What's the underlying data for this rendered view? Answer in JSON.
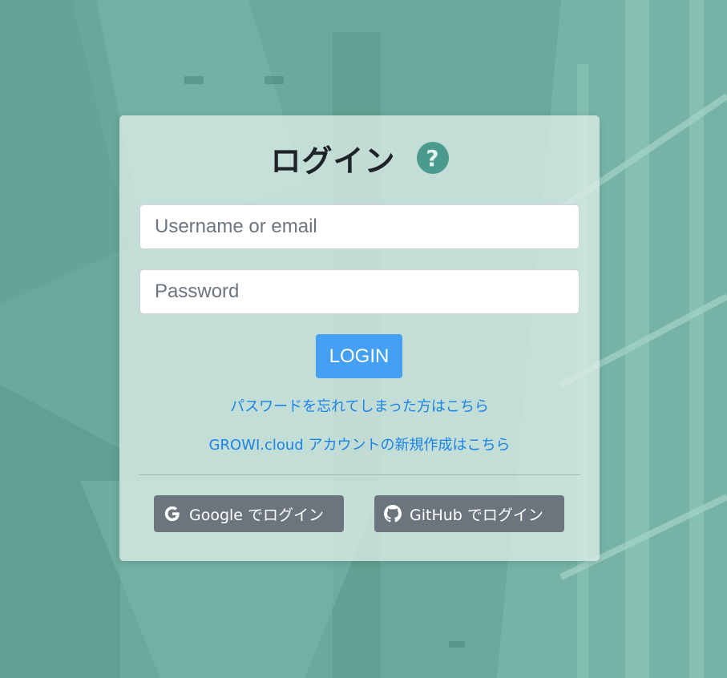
{
  "background": {
    "color": "#6aa99c"
  },
  "login": {
    "title": "ログイン",
    "help_icon": "question-circle-icon",
    "username_placeholder": "Username or email",
    "password_placeholder": "Password",
    "login_label": "LOGIN",
    "forgot_password_link": "パスワードを忘れてしまった方はこちら",
    "create_account_link": "GROWI.cloud アカウントの新規作成はこちら"
  },
  "social": {
    "google": {
      "label": "Google でログイン",
      "icon": "google-icon"
    },
    "github": {
      "label": "GitHub でログイン",
      "icon": "github-icon"
    }
  },
  "colors": {
    "accent": "#43a0f2",
    "link": "#1a84e6",
    "social_button": "#6c757d",
    "help_icon": "#4a9b8d"
  }
}
